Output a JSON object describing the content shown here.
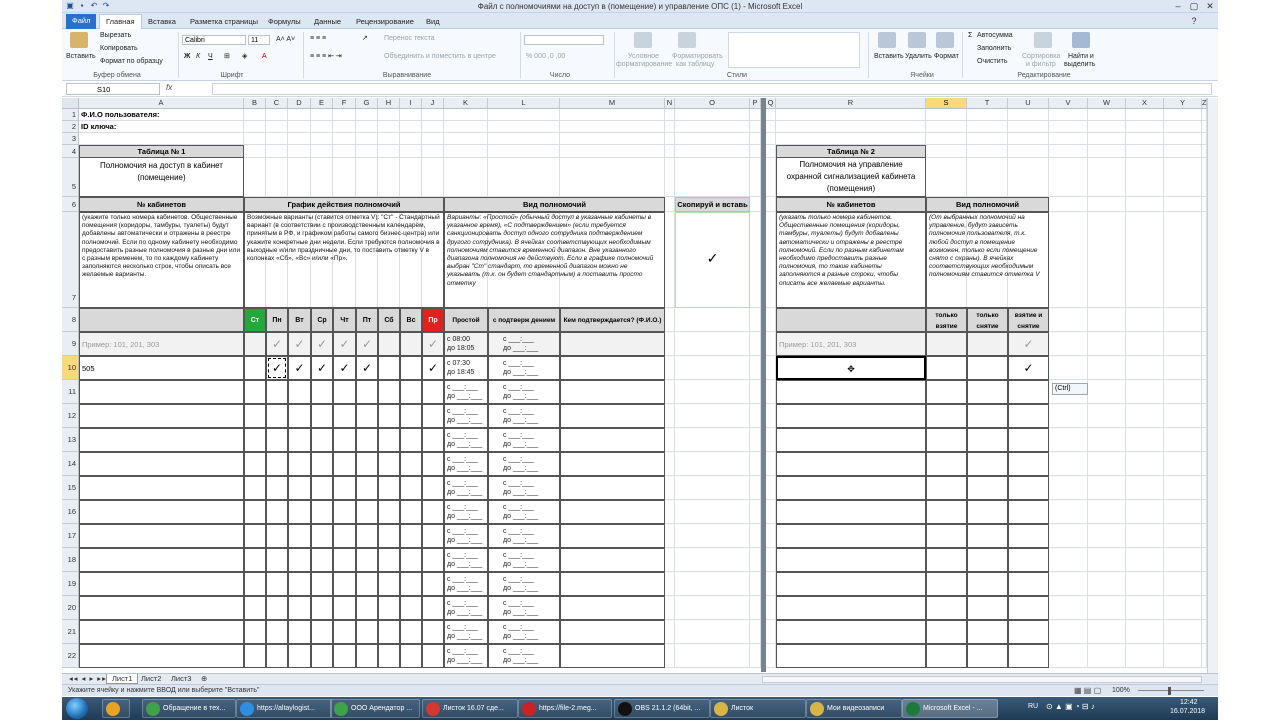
{
  "window": {
    "title": "Файл с полномочиями на доступ в (помещение) и управление ОПС (1)  -  Microsoft Excel"
  },
  "ribbon_tabs": [
    "Файл",
    "Главная",
    "Вставка",
    "Разметка страницы",
    "Формулы",
    "Данные",
    "Рецензирование",
    "Вид"
  ],
  "ribbon": {
    "paste": "Вставить",
    "cut": "Вырезать",
    "copy": "Копировать",
    "format_painter": "Формат по образцу",
    "clipboard": "Буфер обмена",
    "font_name": "Calibri",
    "font_size": "11",
    "font_group": "Шрифт",
    "wrap_text": "Перенос текста",
    "merge_center": "Объединить и поместить в центре",
    "alignment_group": "Выравнивание",
    "number_group": "Число",
    "cond_format": [
      "Условное",
      "форматирование"
    ],
    "format_table": [
      "Форматировать",
      "как таблицу"
    ],
    "styles_group": "Стили",
    "insert": "Вставить",
    "delete": "Удалить",
    "format": "Формат",
    "cells_group": "Ячейки",
    "autosum": "Автосумма",
    "fill": "Заполнить",
    "clear": "Очистить",
    "sort": [
      "Сортировка",
      "и фильтр"
    ],
    "find": [
      "Найти и",
      "выделить"
    ],
    "editing_group": "Редактирование"
  },
  "formula_bar": {
    "name_box": "S10",
    "fx": "fx",
    "value": ""
  },
  "columns_left": [
    "A",
    "B",
    "C",
    "D",
    "E",
    "F",
    "G",
    "H",
    "I",
    "J",
    "K",
    "L",
    "M",
    "N",
    "O",
    "P"
  ],
  "columns_right": [
    "Q",
    "R",
    "S",
    "T",
    "U",
    "V",
    "W",
    "X",
    "Y",
    "Z"
  ],
  "rows": [
    "1",
    "2",
    "3",
    "4",
    "5",
    "6",
    "7",
    "8",
    "9",
    "10",
    "11",
    "12",
    "13",
    "14",
    "15",
    "16",
    "17",
    "18",
    "19",
    "20",
    "21",
    "22"
  ],
  "sheet": {
    "fio_label": "Ф.И.О пользователя:",
    "key_label": "ID ключа:",
    "t1_title": "Таблица № 1",
    "t1_subtitle": "Полномочия на доступ в кабинет (помещение)",
    "t1_rooms_header": "№ кабинетов",
    "t1_schedule_header": "График действия полномочий",
    "t1_type_header": "Вид полномочий",
    "copy_header": "Скопируй и вставь",
    "t1_rooms_note": "(укажите только номера кабинетов. Общественные помещения (коридоры, тамбуры, туалеты) будут добавлены автоматически и отражены в реестре полномочий. Если по одному кабинету необходимо предоставить разные полномочия в разные дни или с разным временем, то по каждому кабинету заполняются несколько строк, чтобы описать все желаемые варианты.",
    "t1_schedule_note": "Возможные варианты (ставится отметка V):  \"Ст\" - Стандартный вариант (в соответствии с производственным календарём, принятым в РФ, и графиком работы самого бизнес-центра) или укажите конкретные дни недели. Если требуются полномочия в выходные и/или праздничные дни, то поставить отметку V в колонках «Сб», «Вс» и/или «Пр».",
    "t1_type_note": "Варианты: «Простой» (обычный доступ в указанные кабинеты в указанное время), «С подтверждением» (если требуется санкционировать доступ одного сотрудника подтверждением другого сотрудника). В ячейках соответствующих необходимым полномочиям ставится временной диапазон. Вне указанного диапазона полномочия не действуют. Если в графике полномочий выбран \"Ст\" стандарт, то временной диапазон можно не указывать (т.к. он будет стандартным) а поставить просто отметку",
    "copy_check": "✓",
    "days": [
      "Ст",
      "Пн",
      "Вт",
      "Ср",
      "Чт",
      "Пт",
      "Сб",
      "Вс",
      "Пр"
    ],
    "type_cols": [
      "Простой",
      "с подтверж дением",
      "Кем подтверждается? (Ф.И.О.)"
    ],
    "example_rooms": "Пример: 101, 201, 303",
    "example_times": [
      "с  08:00",
      "до 18:05",
      "с  ___:___",
      "до ___:___"
    ],
    "example_times2": [
      "с  07:30",
      "до 18:45",
      "с  ___:___",
      "до ___:___"
    ],
    "row10_room": "505",
    "check": "✓",
    "time_from": "с  ___:___",
    "time_to": "до ___:___",
    "t2_title": "Таблица № 2",
    "t2_subtitle": "Полномочия на управление охранной сигнализацией кабинета (помещения)",
    "t2_rooms_header": "№ кабинетов",
    "t2_type_header": "Вид полномочий",
    "t2_rooms_note": "(указать только номера кабинетов. Общественные помещения (коридоры, тамбуры, туалеты) будут добавлены автоматически и отражены в реестре полномочий. Если по разным кабинетам необходимо предоставить разные полномочия, то такие кабинеты заполняются в разные строки, чтобы описать все желаемые варианты.",
    "t2_type_note": "(От выбранных полномочий на управление, будут зависеть полномочия пользователя, т.к. любой доступ в помещение возможен, только если помещение снято с охраны). В ячейках соответствующих необходимым полномочиям ставится отметка V",
    "t2_cols": [
      "только взятие",
      "только снятие",
      "взятие и снятие"
    ],
    "paste_options": "(Ctrl)"
  },
  "sheets": [
    "Лист1",
    "Лист2",
    "Лист3"
  ],
  "status": {
    "text": "Укажите ячейку и нажмите ВВОД или выберите \"Вставить\"",
    "zoom": "100%"
  },
  "taskbar": {
    "items": [
      "Обращение в тех...",
      "https://altaylogist...",
      "ООО Арендатор ...",
      "Листок 16.07 сде...",
      "https://file-2.meg...",
      "OBS 21.1.2 (64bit, ...",
      "Листок",
      "Мои видеозаписи",
      "Microsoft Excel - ..."
    ],
    "lang": "RU",
    "time": "12:42",
    "date": "16.07.2018"
  },
  "colors": {
    "green": "#22a93c",
    "red": "#e0211c",
    "header_gray": "#d9d9d9",
    "select": "#f9d97a"
  }
}
